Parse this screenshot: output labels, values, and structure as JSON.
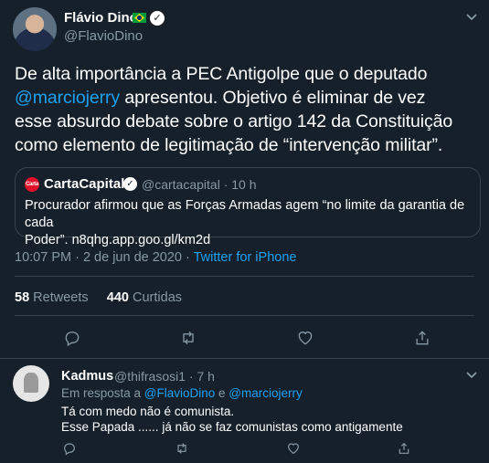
{
  "tweet": {
    "author_name": "Flávio Dino",
    "author_handle": "@FlavioDino",
    "text_line1": "De alta importância a PEC Antigolpe que o deputado",
    "mention": "@marciojerry",
    "text_line2_rest": " apresentou. Objetivo é eliminar de vez",
    "text_line3": "esse absurdo debate sobre o artigo 142 da Constituição",
    "text_line4": "como elemento de legitimação de “intervenção militar”.",
    "quote": {
      "logo_text": "Carta",
      "name": "CartaCapital",
      "handle_time": "@cartacapital · 10 h",
      "text_line1": "Procurador afirmou que as Forças Armadas agem “no limite da garantia de cada",
      "text_line2": "Poder”. n8qhg.app.goo.gl/km2d"
    },
    "timestamp": "10:07 PM · 2 de jun de 2020 · ",
    "source": "Twitter for iPhone",
    "retweets_count": "58",
    "retweets_label": " Retweets",
    "likes_count": "440",
    "likes_label": " Curtidas"
  },
  "reply": {
    "author_name": "Kadmus",
    "handle_time": "@thifrasosi1 · 7 h",
    "in_reply_prefix": "Em resposta a ",
    "in_reply_mention1": "@FlavioDino",
    "in_reply_sep": " e ",
    "in_reply_mention2": "@marciojerry",
    "text_line1": "Tá com medo não é comunista.",
    "text_line2": "Esse Papada ...... já não se faz comunistas como antigamente"
  },
  "icons": [
    "chevron-down-icon",
    "reply-icon",
    "retweet-icon",
    "like-icon",
    "share-icon",
    "verified-icon",
    "brazil-flag-icon"
  ],
  "colors": {
    "background": "#15202b",
    "accent": "#1da1f2",
    "secondary_text": "#8899a6",
    "border": "#38444d"
  }
}
